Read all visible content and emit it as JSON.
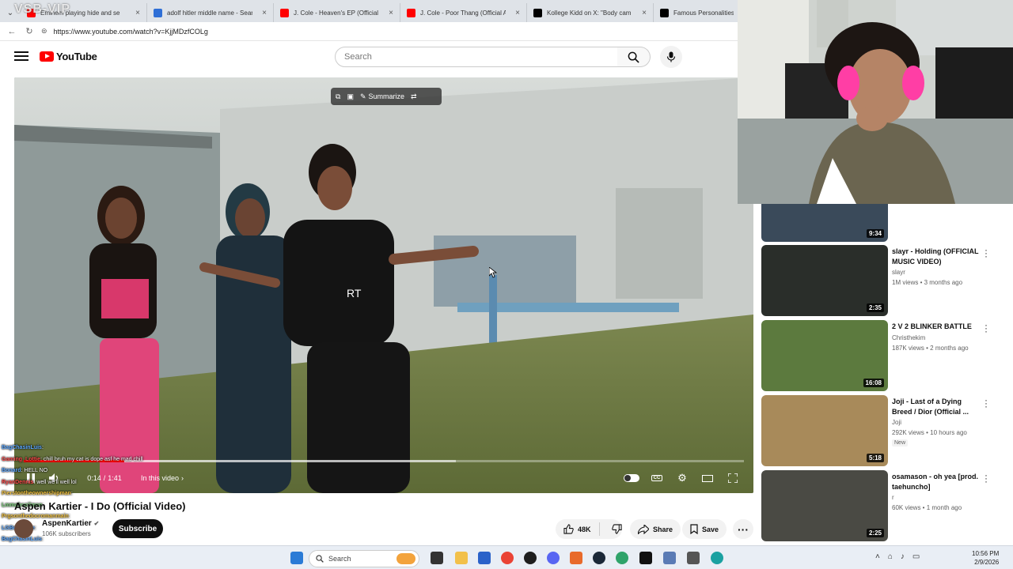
{
  "browser": {
    "tabs": [
      {
        "label": "Eminem playing hide and se",
        "color": "#ff0000"
      },
      {
        "label": "adolf hitler middle name - Search",
        "color": "#2f6fd6"
      },
      {
        "label": "J. Cole - Heaven's EP (Official Mus",
        "color": "#ff0000"
      },
      {
        "label": "J. Cole - Poor Thang (Official Audi",
        "color": "#ff0000"
      },
      {
        "label": "Kollege Kidd on X: \"Body cam foo",
        "color": "#000000"
      },
      {
        "label": "Famous Personalities Faci",
        "color": "#000000"
      }
    ],
    "overlay_text": "VSB-VIP",
    "url": "https://www.youtube.com/watch?v=KjjMDzfCOLg"
  },
  "youtube": {
    "logo_text": "YouTube",
    "search_placeholder": "Search"
  },
  "player": {
    "summarize_label": "Summarize",
    "time_current": "0:14",
    "time_separator": "/",
    "time_total": "1:41",
    "chapter_label": "In this video",
    "progress_played": 0.14,
    "progress_buffered": 0.6
  },
  "chat": [
    {
      "user": "BagChasinLuis",
      "msg": ":",
      "color": "#5da8ff"
    },
    {
      "user": "Gaming_Lottie",
      "msg": ": chill bruh my cat is dope asf he mad chill",
      "color": "#ff4a4a"
    },
    {
      "user": "Bonard",
      "msg": ": HELL NO",
      "color": "#5da8ff"
    },
    {
      "user": "RyanDennis",
      "msg": ": well we'll well lol",
      "color": "#ff4a4a"
    },
    {
      "user": "Pierstontheownershipman",
      "msg": ":",
      "color": "#f5c542"
    },
    {
      "user": "Lmmabsoilman",
      "msg": ":",
      "color": "#7fd37f"
    },
    {
      "user": "Prgsonthedocromanmain",
      "msg": ":",
      "color": "#f5c542"
    },
    {
      "user": "LGBotSpace",
      "msg": ":",
      "color": "#5da8ff"
    },
    {
      "user": "BagChasinLuis",
      "msg": ":",
      "color": "#5da8ff"
    },
    {
      "user": "Pinoydruid21",
      "msg": ":",
      "color": "#5da8ff"
    }
  ],
  "video": {
    "title": "Aspen Kartier - I Do (Official Video)",
    "channel": "AspenKartier",
    "subscribers": "106K subscribers",
    "subscribe_label": "Subscribe",
    "likes": "48K",
    "share_label": "Share",
    "save_label": "Save"
  },
  "recommendations": [
    {
      "title": "",
      "channel": "",
      "meta": "",
      "new_badge": "New",
      "duration": "9:34",
      "top_thumb": "#3a4a5a"
    },
    {
      "title": "slayr - Holding (OFFICIAL MUSIC VIDEO)",
      "channel": "slayr",
      "meta": "1M views • 3 months ago",
      "new_badge": "",
      "duration": "2:35",
      "top_thumb": "#2a2e2a"
    },
    {
      "title": "2 V 2 BLINKER BATTLE",
      "channel": "Christhekim",
      "meta": "187K views • 2 months ago",
      "new_badge": "",
      "duration": "16:08",
      "top_thumb": "#5c7a3e"
    },
    {
      "title": "Joji - Last of a Dying Breed / Dior (Official ...",
      "channel": "Joji",
      "meta": "292K views • 10 hours ago",
      "new_badge": "New",
      "duration": "5:18",
      "top_thumb": "#a88a5a"
    },
    {
      "title": "osamason - oh yea [prod. taehuncho]",
      "channel": "r",
      "meta": "60K views • 1 month ago",
      "new_badge": "",
      "duration": "2:25",
      "top_thumb": "#4a4a44"
    }
  ],
  "taskbar": {
    "search_placeholder": "Search",
    "time": "10:56 PM",
    "date": "2/9/2026"
  }
}
